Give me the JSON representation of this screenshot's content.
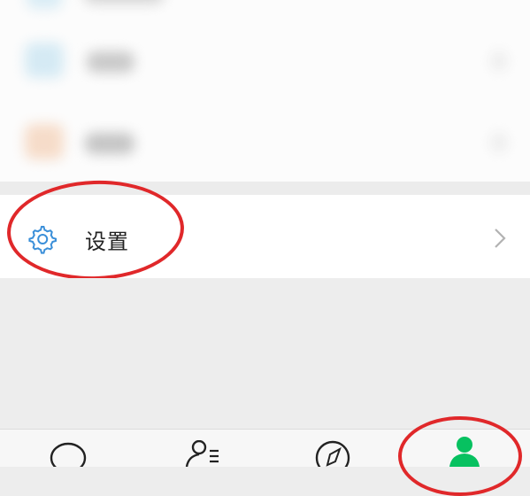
{
  "settings_row": {
    "label": "设置",
    "icon": "gear-icon",
    "chevron_icon": "chevron-right-icon"
  },
  "tabbar": {
    "tabs": [
      {
        "icon": "chat-icon"
      },
      {
        "icon": "contacts-icon"
      },
      {
        "icon": "discover-compass-icon"
      },
      {
        "icon": "me-person-icon",
        "active": true
      }
    ]
  },
  "colors": {
    "accent_green": "#07c160",
    "gear_blue": "#3a8fd9",
    "highlight_red": "#e0282a"
  }
}
